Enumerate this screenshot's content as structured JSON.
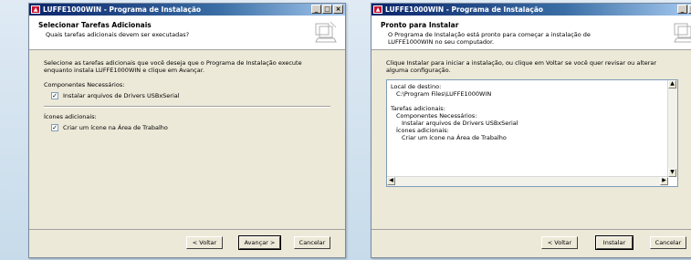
{
  "window1": {
    "title": "LUFFE1000WIN - Programa de Instalação",
    "header_title": "Selecionar Tarefas Adicionais",
    "header_sub": "Quais tarefas adicionais devem ser executadas?",
    "instruction": "Selecione as tarefas adicionais que você deseja que o Programa de Instalação execute enquanto instala LUFFE1000WIN e clique em Avançar.",
    "group1": "Componentes Necessários:",
    "check1": "Instalar arquivos de Drivers USBxSerial",
    "group2": "Ícones adicionais:",
    "check2": "Criar um ícone na Área de Trabalho",
    "buttons": {
      "back": "< Voltar",
      "next": "Avançar >",
      "cancel": "Cancelar"
    }
  },
  "window2": {
    "title": "LUFFE1000WIN - Programa de Instalação",
    "header_title": "Pronto para Instalar",
    "header_sub": "O Programa de Instalação está pronto para começar a instalação de LUFFE1000WIN no seu computador.",
    "instruction": "Clique Instalar para iniciar a instalação, ou clique em Voltar se você quer revisar ou alterar alguma configuração.",
    "memo": {
      "dest_label": "Local de destino:",
      "dest_value": "C:\\Program Files\\LUFFE1000WIN",
      "tasks_label": "Tarefas adicionais:",
      "comp_label": "Componentes Necessários:",
      "comp_item": "Instalar arquivos de Drivers USBxSerial",
      "icons_label": "Ícones adicionais:",
      "icons_item": "Criar um ícone na Área de Trabalho"
    },
    "buttons": {
      "back": "< Voltar",
      "install": "Instalar",
      "cancel": "Cancelar"
    }
  }
}
